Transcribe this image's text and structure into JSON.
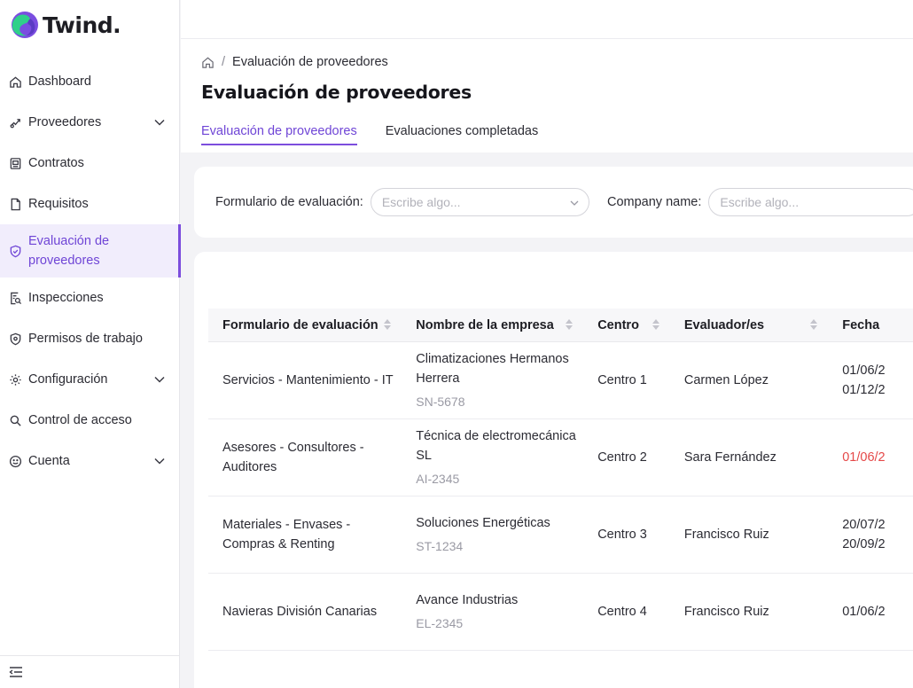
{
  "brand": {
    "name": "Twind.",
    "colors": {
      "accent": "#7c4ddd",
      "logo_green": "#2fd08a",
      "logo_purple": "#7a4de0",
      "danger": "#e54848"
    }
  },
  "sidebar": {
    "items": [
      {
        "label": "Dashboard",
        "icon": "home-icon",
        "has_children": false
      },
      {
        "label": "Proveedores",
        "icon": "handshake-icon",
        "has_children": true
      },
      {
        "label": "Contratos",
        "icon": "contract-icon",
        "has_children": false
      },
      {
        "label": "Requisitos",
        "icon": "document-icon",
        "has_children": false
      },
      {
        "label": "Evaluación de proveedores",
        "icon": "shield-check-icon",
        "has_children": false,
        "active": true
      },
      {
        "label": "Inspecciones",
        "icon": "inspection-icon",
        "has_children": false
      },
      {
        "label": "Permisos de trabajo",
        "icon": "permit-icon",
        "has_children": false
      },
      {
        "label": "Configuración",
        "icon": "gear-icon",
        "has_children": true
      },
      {
        "label": "Control de acceso",
        "icon": "search-icon",
        "has_children": false
      },
      {
        "label": "Cuenta",
        "icon": "smiley-icon",
        "has_children": true
      }
    ],
    "footer_icon": "collapse-menu-icon"
  },
  "breadcrumb": {
    "home_icon": "home-icon",
    "current": "Evaluación de proveedores"
  },
  "page": {
    "title": "Evaluación de proveedores"
  },
  "tabs": [
    {
      "label": "Evaluación de proveedores",
      "active": true
    },
    {
      "label": "Evaluaciones completadas",
      "active": false
    }
  ],
  "filters": {
    "form": {
      "label": "Formulario de evaluación:",
      "placeholder": "Escribe algo..."
    },
    "company": {
      "label": "Company name:",
      "placeholder": "Escribe algo..."
    }
  },
  "table": {
    "headers": [
      "Formulario de evaluación",
      "Nombre de la empresa",
      "Centro",
      "Evaluador/es",
      "Fecha"
    ],
    "rows": [
      {
        "form": "Servicios - Mantenimiento - IT",
        "company": "Climatizaciones Hermanos Herrera",
        "code": "SN-5678",
        "centro": "Centro 1",
        "evaluator": "Carmen López",
        "dates": [
          "01/06/2",
          "01/12/2"
        ],
        "overdue": false
      },
      {
        "form": "Asesores - Consultores - Auditores",
        "company": "Técnica de electromecánica SL",
        "code": "AI-2345",
        "centro": "Centro 2",
        "evaluator": "Sara Fernández",
        "dates": [
          "01/06/2"
        ],
        "overdue": true
      },
      {
        "form": "Materiales - Envases - Compras & Renting",
        "company": "Soluciones Energéticas",
        "code": "ST-1234",
        "centro": "Centro 3",
        "evaluator": "Francisco Ruiz",
        "dates": [
          "20/07/2",
          "20/09/2"
        ],
        "overdue": false
      },
      {
        "form": "Navieras División Canarias",
        "company": "Avance Industrias",
        "code": "EL-2345",
        "centro": "Centro 4",
        "evaluator": "Francisco Ruiz",
        "dates": [
          "01/06/2"
        ],
        "overdue": false
      }
    ]
  }
}
